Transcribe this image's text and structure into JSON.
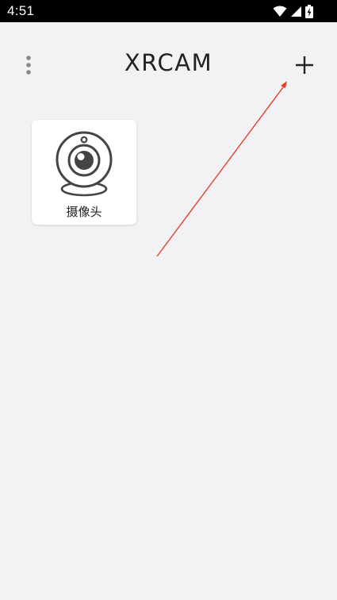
{
  "status_bar": {
    "time": "4:51",
    "icons": [
      "wifi-icon",
      "signal-icon",
      "battery-charging-icon"
    ]
  },
  "header": {
    "title": "XRCAM",
    "menu_icon": "more-vertical-icon",
    "add_icon": "plus-icon"
  },
  "devices": [
    {
      "label": "摄像头",
      "icon": "webcam-icon"
    }
  ],
  "colors": {
    "background": "#f2f2f4",
    "status_bar": "#000000",
    "card": "#ffffff",
    "icon_stroke": "#444444",
    "annotation_arrow": "#e0402a"
  }
}
